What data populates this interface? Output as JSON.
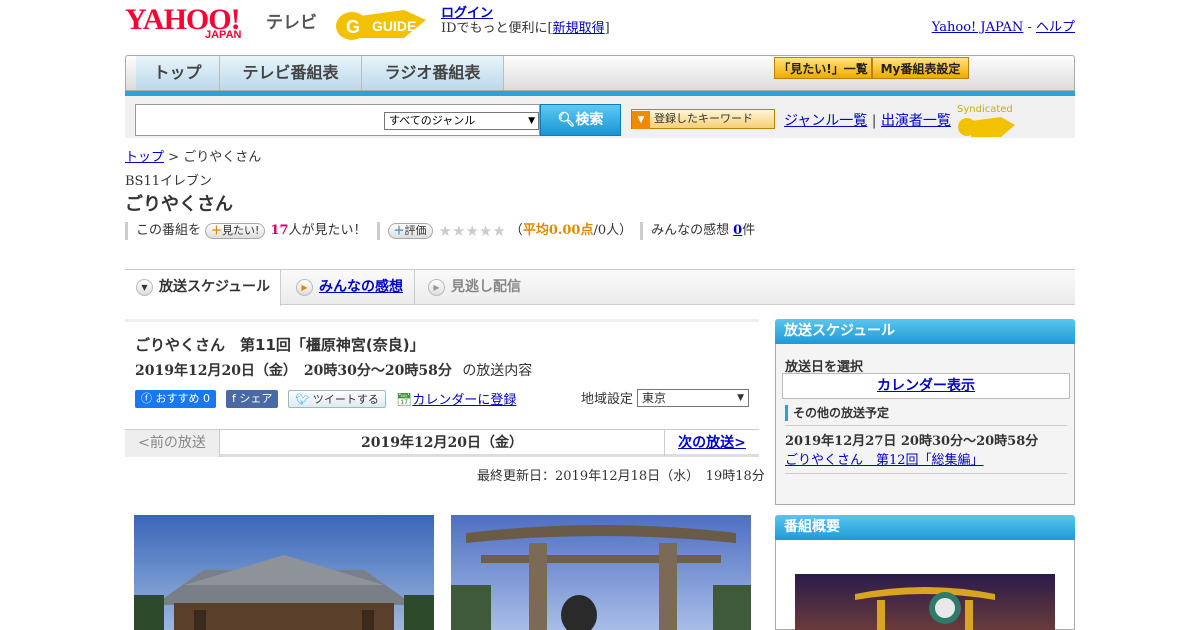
{
  "header": {
    "yahoo_logo": "YAHOO!",
    "yahoo_sub": "JAPAN",
    "tv_label": "テレビ",
    "gguide_logo": "GUIDE",
    "login_label": "ログイン",
    "login_sub_prefix": "IDでもっと便利に[",
    "register_label": "新規取得",
    "login_sub_suffix": "]",
    "yahoo_japan_link": "Yahoo! JAPAN",
    "help_sep": " - ",
    "help_link": "ヘルプ"
  },
  "nav": {
    "tabs": [
      "トップ",
      "テレビ番組表",
      "ラジオ番組表"
    ],
    "want_list": "「見たい!」一覧",
    "my_schedule": "My番組表設定"
  },
  "search": {
    "genre_selected": "すべてのジャンル",
    "search_button": "検索",
    "keyword_button": "登録したキーワード",
    "genre_link": "ジャンル一覧",
    "link_sep": "|",
    "performer_link": "出演者一覧",
    "syndicated": "Syndicated"
  },
  "breadcrumb": {
    "top": "トップ",
    "sep": " > ",
    "current": "ごりやくさん"
  },
  "program": {
    "channel": "BS11イレブン",
    "title": "ごりやくさん",
    "this_program": "この番組を",
    "want_button": "見たい!",
    "want_count": "17",
    "want_suffix": "人が見たい！",
    "rate_button": "評価",
    "stars": "★★★★★",
    "avg_prefix": "（",
    "avg_label": "平均0.00点",
    "avg_suffix": "/0人）",
    "impressions_label": "みんなの感想",
    "impressions_count": "0",
    "impressions_unit": "件"
  },
  "tabs": {
    "schedule": "放送スケジュール",
    "impressions": "みんなの感想",
    "streaming": "見逃し配信"
  },
  "episode": {
    "title": "ごりやくさん　第11回「橿原神宮(奈良)」",
    "datetime": "2019年12月20日（金）　20時30分～20時58分",
    "datetime_suffix": "の放送内容",
    "recommend": "おすすめ 0",
    "share": "シェア",
    "tweet": "ツイートする",
    "calendar_register": "カレンダーに登録",
    "region_label": "地域設定",
    "region_value": "東京"
  },
  "pager": {
    "prev": "<前の放送",
    "current": "2019年12月20日（金）",
    "next": "次の放送>"
  },
  "updated": "最終更新日：2019年12月18日（水）　19時18分",
  "sidebar": {
    "schedule_head": "放送スケジュール",
    "select_date": "放送日を選択",
    "calendar_button": "カレンダー表示",
    "other_head": "その他の放送予定",
    "other_date": "2019年12月27日  20時30分～20時58分",
    "other_link": "ごりやくさん　第12回「総集編」",
    "overview_head": "番組概要"
  },
  "colors": {
    "brand_red": "#ff0033",
    "accent_blue": "#2aa2dc",
    "link_blue": "#0000cc",
    "gold": "#f0a900"
  }
}
